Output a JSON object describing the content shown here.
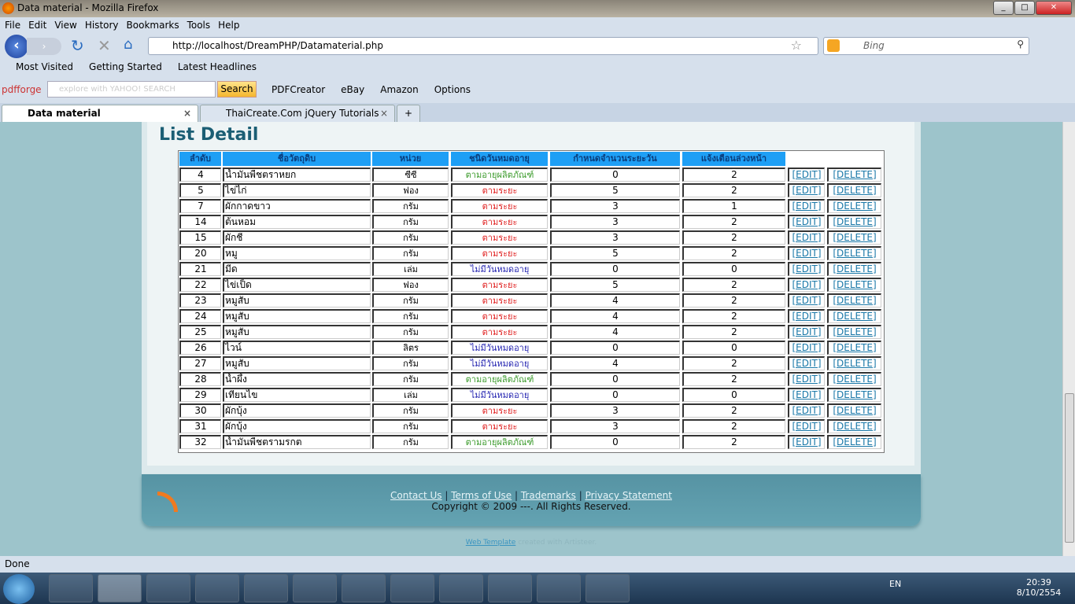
{
  "window": {
    "title": "Data material - Mozilla Firefox"
  },
  "menu": [
    "File",
    "Edit",
    "View",
    "History",
    "Bookmarks",
    "Tools",
    "Help"
  ],
  "url": "http://localhost/DreamPHP/Datamaterial.php",
  "search_placeholder": "Bing",
  "bookmarks": [
    "Most Visited",
    "Getting Started",
    "Latest Headlines"
  ],
  "toolbar": {
    "brand": "pdfforge",
    "yahoo_placeholder": "explore with YAHOO! SEARCH",
    "search_button": "Search",
    "items": [
      "PDFCreator",
      "eBay",
      "Amazon",
      "Options"
    ]
  },
  "tabs": [
    {
      "label": "Data material",
      "active": true
    },
    {
      "label": "ThaiCreate.Com jQuery Tutorials",
      "active": false
    }
  ],
  "page": {
    "title": "List Detail"
  },
  "table": {
    "headers": [
      "ลำดับ",
      "ชื่อวัตถุดิบ",
      "หน่วย",
      "ชนิดวันหมดอายุ",
      "กำหนดจำนวนระยะวัน",
      "แจ้งเตือนล่วงหน้า"
    ],
    "edit_label": "[EDIT]",
    "delete_label": "[DELETE]",
    "type_colors": {
      "ตามอายุผลิตภัณฑ์": "#3a9a2a",
      "ตามระยะ": "#e02020",
      "ไม่มีวันหมดอายุ": "#2222b0"
    },
    "rows": [
      [
        "4",
        "น้ำมันพืชตราหยก",
        "ซีซี",
        "ตามอายุผลิตภัณฑ์",
        "0",
        "2"
      ],
      [
        "5",
        "ไข่ไก่",
        "ฟอง",
        "ตามระยะ",
        "5",
        "2"
      ],
      [
        "7",
        "ผักกาดขาว",
        "กรัม",
        "ตามระยะ",
        "3",
        "1"
      ],
      [
        "14",
        "ต้นหอม",
        "กรัม",
        "ตามระยะ",
        "3",
        "2"
      ],
      [
        "15",
        "ผักชี",
        "กรัม",
        "ตามระยะ",
        "3",
        "2"
      ],
      [
        "20",
        "หมู",
        "กรัม",
        "ตามระยะ",
        "5",
        "2"
      ],
      [
        "21",
        "มีด",
        "เล่ม",
        "ไม่มีวันหมดอายุ",
        "0",
        "0"
      ],
      [
        "22",
        "ไข่เป็ด",
        "ฟอง",
        "ตามระยะ",
        "5",
        "2"
      ],
      [
        "23",
        "หมูสับ",
        "กรัม",
        "ตามระยะ",
        "4",
        "2"
      ],
      [
        "24",
        "หมูสับ",
        "กรัม",
        "ตามระยะ",
        "4",
        "2"
      ],
      [
        "25",
        "หมูสับ",
        "กรัม",
        "ตามระยะ",
        "4",
        "2"
      ],
      [
        "26",
        "ไวน์",
        "ลิตร",
        "ไม่มีวันหมดอายุ",
        "0",
        "0"
      ],
      [
        "27",
        "หมูสับ",
        "กรัม",
        "ไม่มีวันหมดอายุ",
        "4",
        "2"
      ],
      [
        "28",
        "น้ำผึ้ง",
        "กรัม",
        "ตามอายุผลิตภัณฑ์",
        "0",
        "2"
      ],
      [
        "29",
        "เทียนไข",
        "เล่ม",
        "ไม่มีวันหมดอายุ",
        "0",
        "0"
      ],
      [
        "30",
        "ผักบุ้ง",
        "กรัม",
        "ตามระยะ",
        "3",
        "2"
      ],
      [
        "31",
        "ผักบุ้ง",
        "กรัม",
        "ตามระยะ",
        "3",
        "2"
      ],
      [
        "32",
        "น้ำมันพืชตรามรกต",
        "กรัม",
        "ตามอายุผลิตภัณฑ์",
        "0",
        "2"
      ]
    ]
  },
  "footer": {
    "links": [
      "Contact Us",
      "Terms of Use",
      "Trademarks",
      "Privacy Statement"
    ],
    "copyright": "Copyright © 2009 ---. All Rights Reserved.",
    "template_link": "Web Template",
    "template_suffix": " created with Artisteer."
  },
  "status": "Done",
  "tray": {
    "lang": "EN",
    "time": "20:39",
    "date": "8/10/2554"
  }
}
